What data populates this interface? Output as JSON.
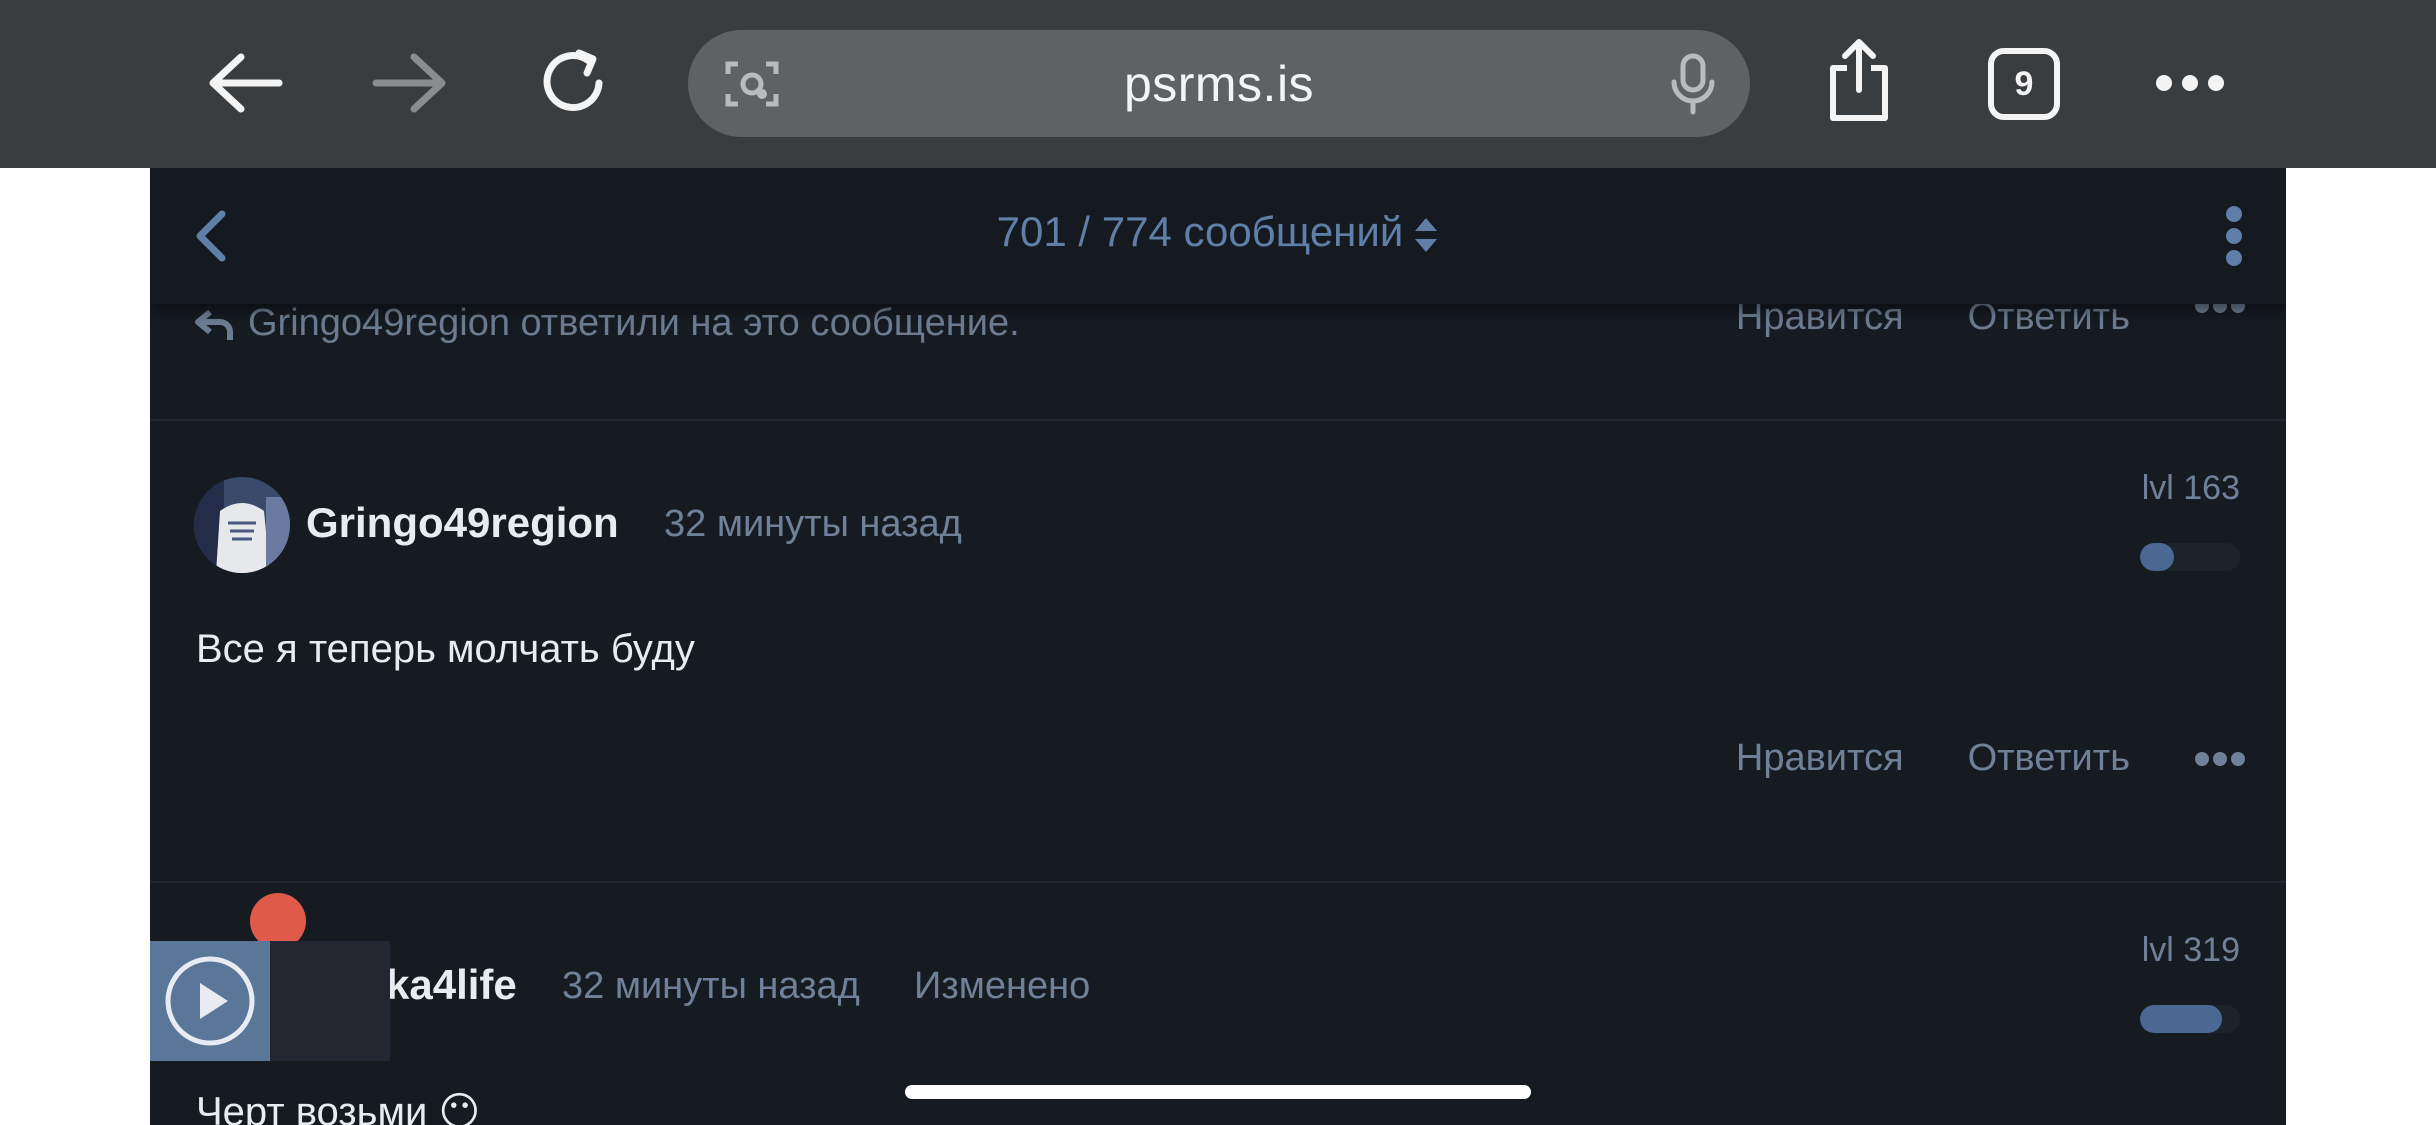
{
  "browser": {
    "url": "psrms.is",
    "tab_count": "9",
    "icons": [
      "back-arrow-icon",
      "forward-arrow-icon",
      "reload-icon",
      "lens-icon",
      "mic-icon",
      "share-icon",
      "tabs-icon",
      "more-icon"
    ]
  },
  "thread": {
    "position_label": "701 / 774 сообщений"
  },
  "prev_post": {
    "reply_notice": "Gringo49region ответили на это сообщение.",
    "like_label": "Нравится",
    "reply_label": "Ответить"
  },
  "posts": [
    {
      "username": "Gringo49region",
      "time": "32 минуты назад",
      "level": "lvl 163",
      "level_fill": 0.3,
      "message": "Все я теперь молчать буду",
      "like_label": "Нравится",
      "reply_label": "Ответить"
    },
    {
      "username": "ka4life",
      "time": "32 минуты назад",
      "edited": "Изменено",
      "level": "lvl 319",
      "level_fill": 0.8,
      "message": "Черт возьми 😶"
    }
  ],
  "colors": {
    "browser_bar": "#3a3d40",
    "page_bg": "#161b22",
    "accent": "#5f7ea8",
    "muted_text": "#6f8199",
    "level_fill": "#4a6892"
  }
}
